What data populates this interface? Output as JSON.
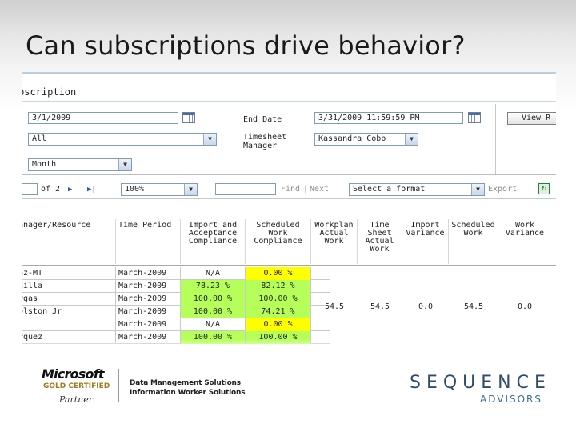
{
  "slide": {
    "title": "Can subscriptions drive behavior?"
  },
  "report": {
    "header": "bscription",
    "params": {
      "start_date": "3/1/2009",
      "end_date_label": "End Date",
      "end_date": "3/31/2009 11:59:59 PM",
      "view_button": "View R",
      "resource_select": "All",
      "timesheet_manager_label_1": "Timesheet",
      "timesheet_manager_label_2": "Manager",
      "timesheet_manager_value": "Kassandra Cobb",
      "period_select": "Month"
    },
    "toolbar": {
      "page_of": "of 2",
      "zoom": "100%",
      "find": "Find",
      "separator": "|",
      "next": "Next",
      "format": "Select a format",
      "export": "Export"
    },
    "columns": [
      "anager/Resource",
      "Time Period",
      "Import and Acceptance Compliance",
      "Scheduled Work Compliance",
      "Workplan Actual Work",
      "Time Sheet Actual Work",
      "Import Variance",
      "Scheduled Work",
      "Work Variance"
    ],
    "rows": [
      {
        "resource": "az-MT",
        "period": "March-2009",
        "import": "N/A",
        "scheduled": "0.00 %",
        "import_color": "none",
        "scheduled_color": "yellow"
      },
      {
        "resource": "dilla",
        "period": "March-2009",
        "import": "78.23 %",
        "scheduled": "82.12 %",
        "import_color": "green",
        "scheduled_color": "green"
      },
      {
        "resource": "rgas",
        "period": "March-2009",
        "import": "100.00 %",
        "scheduled": "100.00 %",
        "import_color": "green",
        "scheduled_color": "green"
      },
      {
        "resource": "olston Jr",
        "period": "March-2009",
        "import": "100.00 %",
        "scheduled": "74.21 %",
        "import_color": "green",
        "scheduled_color": "green"
      },
      {
        "resource": "",
        "period": "March-2009",
        "import": "N/A",
        "scheduled": "0.00 %",
        "import_color": "none",
        "scheduled_color": "yellow"
      },
      {
        "resource": "rquez",
        "period": "March-2009",
        "import": "100.00 %",
        "scheduled": "100.00 %",
        "import_color": "green",
        "scheduled_color": "green"
      }
    ],
    "merged_values": {
      "workplan_actual": "54.5",
      "timesheet_actual": "54.5",
      "import_variance": "0.0",
      "scheduled_work": "54.5",
      "work_variance": "0.0"
    },
    "colors": {
      "green": "#b6ff5a",
      "yellow": "#ffff00"
    }
  },
  "footer": {
    "ms_word": "Microsoft",
    "ms_gold": "GOLD CERTIFIED",
    "ms_partner": "Partner",
    "solutions": [
      "Data Management Solutions",
      "Information Worker Solutions"
    ],
    "sequence": "SEQUENCE",
    "advisors": "ADVISORS"
  }
}
